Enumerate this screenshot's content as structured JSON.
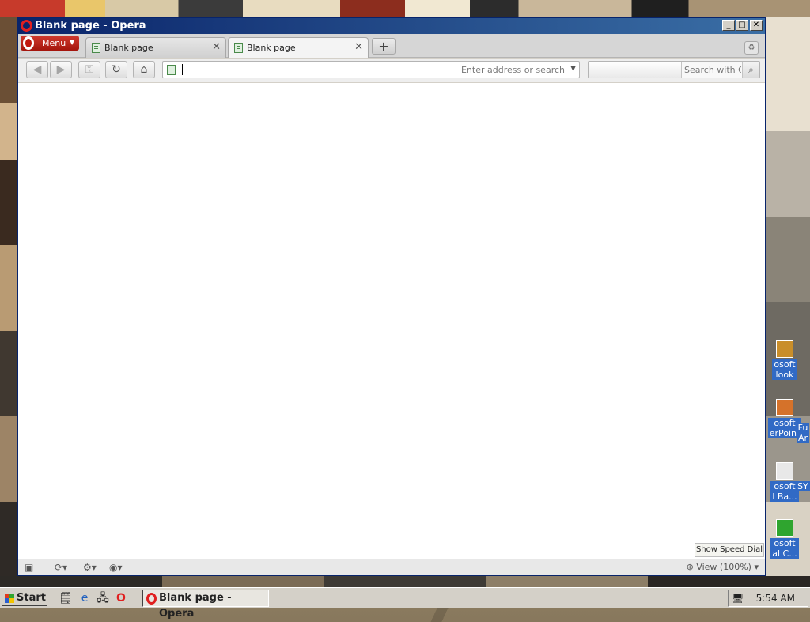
{
  "window": {
    "title": "Blank page - Opera"
  },
  "menu": {
    "label": "Menu"
  },
  "tabs": [
    {
      "label": "Blank page",
      "active": false
    },
    {
      "label": "Blank page",
      "active": true
    }
  ],
  "address_bar": {
    "value": "",
    "placeholder": "Enter address or search"
  },
  "search": {
    "placeholder": "Search with Co"
  },
  "status": {
    "speed_dial_tooltip": "Show Speed Dial",
    "zoom": "View (100%)"
  },
  "desktop_icons": [
    {
      "label": "osoft\nlook"
    },
    {
      "label": "osoft\nerPoint"
    },
    {
      "label": "Fu\nAr"
    },
    {
      "label": "osoft\nl Ba..."
    },
    {
      "label": "SY"
    },
    {
      "label": "osoft\nal C..."
    }
  ],
  "taskbar": {
    "start": "Start",
    "active_task": "Blank page - Opera",
    "clock": "5:54 AM"
  },
  "colors": {
    "title_gradient_start": "#0a246a",
    "title_gradient_end": "#3a6ea5",
    "opera_red": "#c0180e",
    "selection_blue": "#316ac5"
  }
}
